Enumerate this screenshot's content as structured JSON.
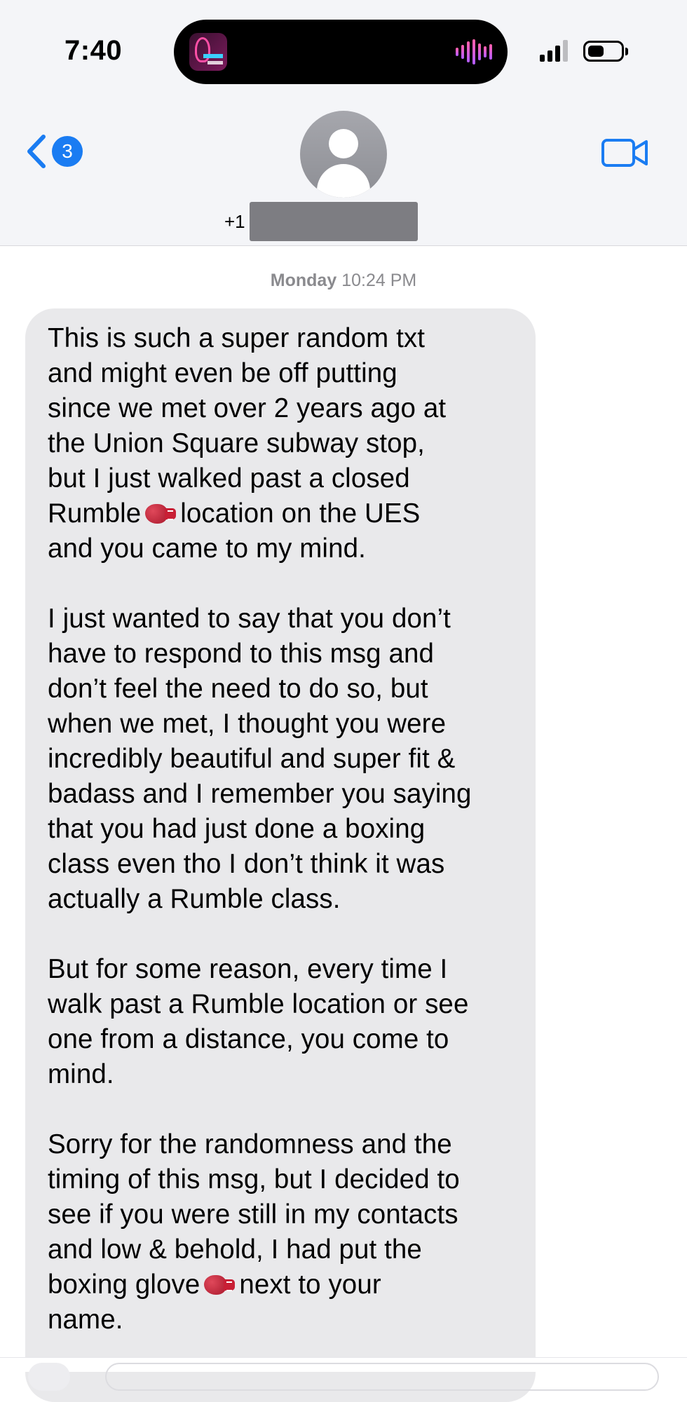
{
  "status_bar": {
    "time": "7:40",
    "dynamic_island_app": "music-app-icon",
    "dynamic_island_activity": "audio-waveform-icon",
    "signal_bars": 3,
    "battery_level": 0.4
  },
  "header": {
    "back_unread_count": "3",
    "contact_prefix": "+1",
    "contact_name_redacted": true,
    "back_icon": "chevron-left-icon",
    "video_icon": "video-camera-icon",
    "avatar_icon": "person-silhouette-icon"
  },
  "thread": {
    "timestamp_day": "Monday",
    "timestamp_time": "10:24 PM"
  },
  "message": {
    "p1_before": "This is such a super random txt\nand might even be off putting\nsince we met over 2 years ago at\nthe Union Square subway stop,\nbut I just walked past a closed\nRumble",
    "p1_after": "location on the UES\nand you came to my mind.",
    "p2": "I just wanted to say that you don’t\nhave to respond to this msg and\ndon’t feel the need to do so, but\nwhen we met, I thought you were\nincredibly beautiful and super fit &\nbadass and I remember you saying\nthat you had just done a boxing\nclass even tho I don’t think it was\nactually a Rumble class.",
    "p3": "But for some reason, every time I\nwalk past a Rumble location or see\none from a distance, you come to\nmind.",
    "p4_before": "Sorry for the randomness and the\ntiming of this msg, but I decided to\nsee if you were still in my contacts\nand low & behold, I had put the\nboxing glove",
    "p4_after": "next to your\nname.",
    "emoji": "boxing-glove-emoji"
  },
  "colors": {
    "accent": "#1a7cf2",
    "bubble": "#e9e9eb",
    "header_bg": "#f4f5f8",
    "timestamp": "#8a8a8e"
  }
}
